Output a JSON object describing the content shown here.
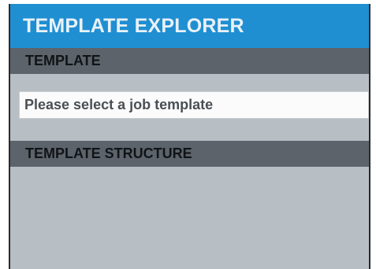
{
  "panel": {
    "title": "TEMPLATE EXPLORER"
  },
  "template_section": {
    "header": "TEMPLATE",
    "select_text": "Please select a job template"
  },
  "structure_section": {
    "header": "TEMPLATE STRUCTURE"
  },
  "colors": {
    "title_bar": "#1f8fd2",
    "section_header": "#5c636a",
    "panel_background": "#b7bec4",
    "select_background": "#fbfbfb"
  }
}
